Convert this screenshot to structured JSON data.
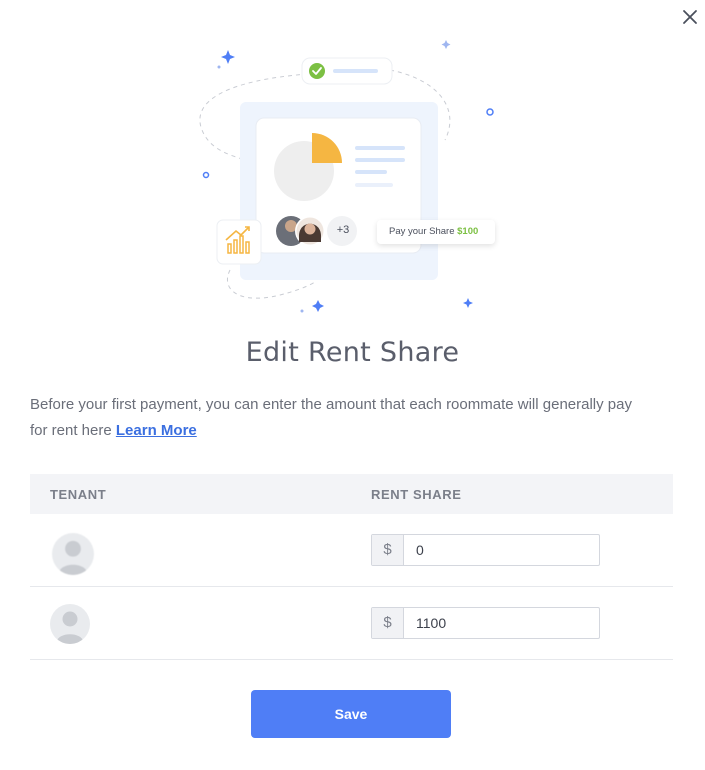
{
  "modal": {
    "title": "Edit Rent Share",
    "description": "Before your first payment, you can enter the amount that each roommate will generally pay for rent here",
    "learn_more": "Learn More",
    "save_label": "Save"
  },
  "illustration": {
    "extra_count": "+3",
    "pay_label": "Pay your Share",
    "pay_amount": "$100"
  },
  "table": {
    "headers": {
      "tenant": "TENANT",
      "rent_share": "RENT SHARE"
    },
    "rows": [
      {
        "currency": "$",
        "amount": "0"
      },
      {
        "currency": "$",
        "amount": "1100"
      }
    ]
  },
  "colors": {
    "accent": "#4f7ef6",
    "link": "#3b6fe0",
    "chart_orange": "#f5b642",
    "success_green": "#7cc043"
  }
}
